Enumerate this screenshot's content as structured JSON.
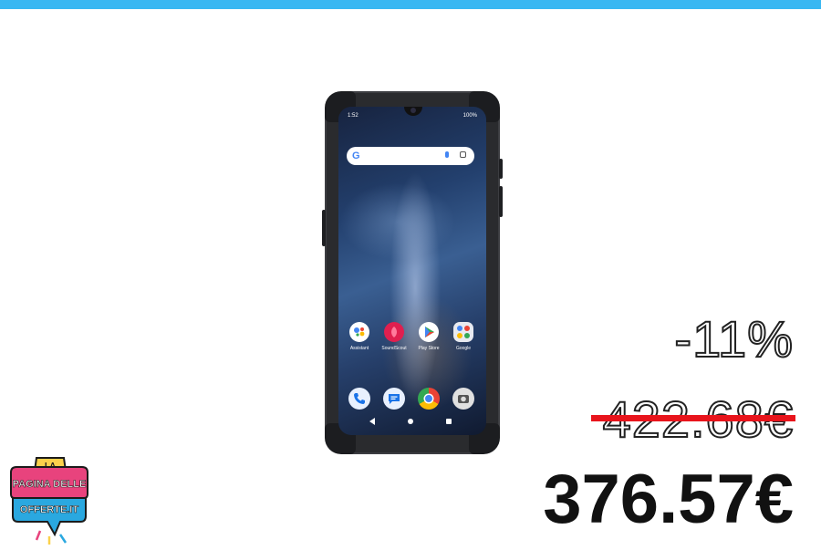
{
  "product": {
    "phone_status_time": "1:52",
    "phone_status_battery": "100%",
    "apps": [
      {
        "label": "Assistant"
      },
      {
        "label": "SoundScout"
      },
      {
        "label": "Play Store"
      },
      {
        "label": "Google"
      }
    ]
  },
  "pricing": {
    "discount": "-11%",
    "old_price": "422.68€",
    "new_price": "376.57€"
  },
  "logo": {
    "line1": "LA",
    "line2": "PAGINA DELLE",
    "line3": "OFFERTE.IT"
  },
  "colors": {
    "top_bar": "#39b7f2",
    "strike": "#e8141c",
    "logo_pink": "#e8437d",
    "logo_blue": "#2aa8e0"
  }
}
